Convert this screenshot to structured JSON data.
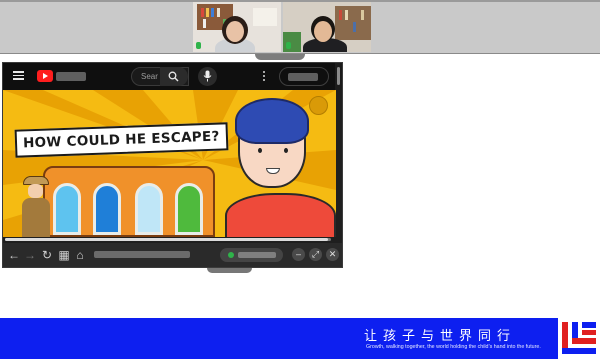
{
  "call": {
    "participants": [
      {
        "name": "",
        "mic": "mic-on-icon"
      },
      {
        "name": "",
        "mic": "mic-on-icon"
      }
    ]
  },
  "browser": {
    "search_placeholder": "Sear",
    "video": {
      "caption": "HOW COULD HE ESCAPE?",
      "progress_fraction": 0.99
    }
  },
  "banner": {
    "title": "让孩子与世界同行",
    "subtitle": "Growth, walking together, the world holding the child’s hand into the future.",
    "colors": {
      "background": "#0d1ff0",
      "logo_red": "#e02020",
      "logo_blue": "#0d1ff0"
    }
  },
  "icons": [
    "menu-icon",
    "youtube-logo-icon",
    "search-icon",
    "mic-icon",
    "more-vert-icon",
    "back-icon",
    "forward-icon",
    "reload-icon",
    "grid-icon",
    "home-icon",
    "minimize-icon",
    "restore-icon",
    "close-icon"
  ]
}
